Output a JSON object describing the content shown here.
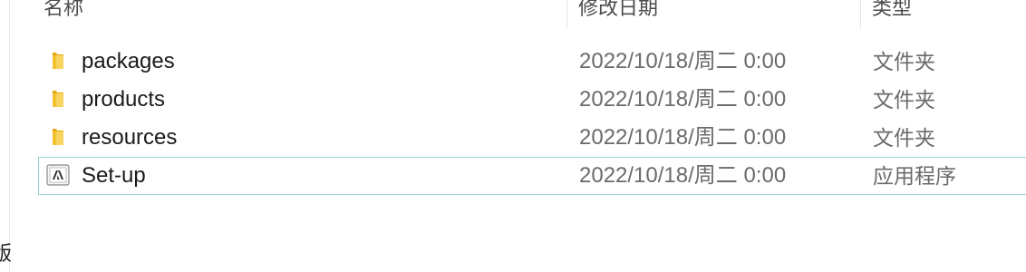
{
  "columns": {
    "name": "名称",
    "date": "修改日期",
    "type": "类型"
  },
  "nav_pane": {
    "fragment": "版"
  },
  "files": [
    {
      "name": "packages",
      "modified": "2022/10/18/周二 0:00",
      "type": "文件夹",
      "icon": "folder-icon"
    },
    {
      "name": "products",
      "modified": "2022/10/18/周二 0:00",
      "type": "文件夹",
      "icon": "folder-icon"
    },
    {
      "name": "resources",
      "modified": "2022/10/18/周二 0:00",
      "type": "文件夹",
      "icon": "folder-icon"
    },
    {
      "name": "Set-up",
      "modified": "2022/10/18/周二 0:00",
      "type": "应用程序",
      "icon": "adobe-app-icon"
    }
  ],
  "colors": {
    "folder": "#f4c542",
    "focus_border": "#9fd3d9"
  }
}
